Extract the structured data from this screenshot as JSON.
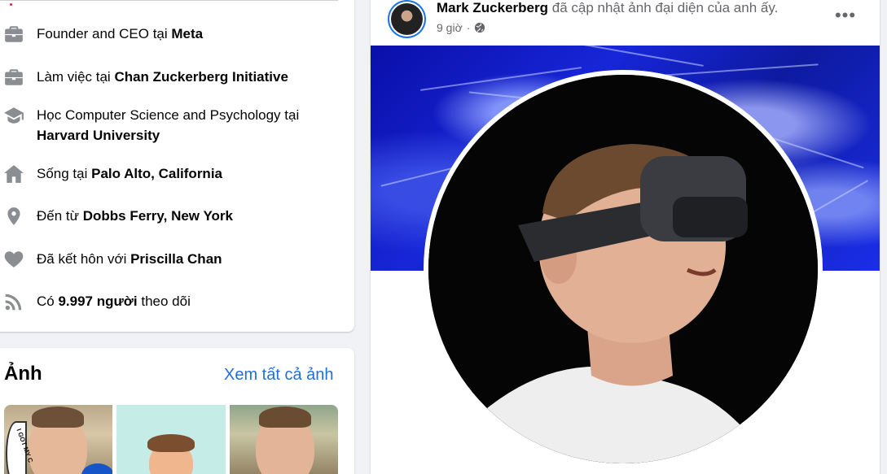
{
  "intro": {
    "items": [
      {
        "icon": "briefcase-icon",
        "prefix": "Founder and CEO tại ",
        "bold": "Meta"
      },
      {
        "icon": "briefcase-icon",
        "prefix": "Làm việc tại ",
        "bold": "Chan Zuckerberg Initiative"
      },
      {
        "icon": "graduation-cap-icon",
        "prefix": "Học Computer Science and Psychology tại ",
        "bold": "Harvard University"
      },
      {
        "icon": "home-icon",
        "prefix": "Sống tại ",
        "bold": "Palo Alto, California"
      },
      {
        "icon": "location-pin-icon",
        "prefix": "Đến từ ",
        "bold": "Dobbs Ferry, New York"
      },
      {
        "icon": "heart-icon",
        "prefix": "Đã kết hôn với ",
        "bold": "Priscilla Chan"
      },
      {
        "icon": "rss-feed-icon",
        "prefix": "Có ",
        "bold": "9.997 người",
        "suffix": " theo dõi"
      }
    ]
  },
  "photos": {
    "title": "Ảnh",
    "see_all": "Xem tất cả ảnh",
    "badge_text": "I GOT MY C"
  },
  "post": {
    "author": "Mark Zuckerberg",
    "action": "đã cập nhật ảnh đại diện của anh ấy.",
    "time": "9 giờ",
    "privacy_icon": "globe-icon",
    "more_label": "•••"
  },
  "colors": {
    "link": "#216fdb",
    "accent": "#1b74e4",
    "icon_gray": "#8a8d91"
  }
}
